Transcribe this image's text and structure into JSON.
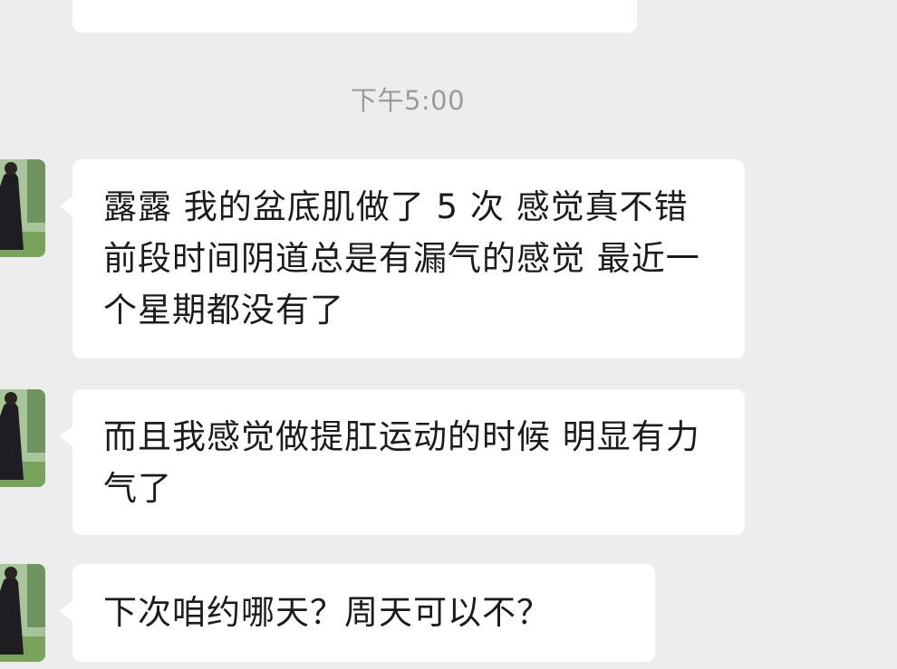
{
  "chat": {
    "timestamp": "下午5:00",
    "messages": [
      {
        "text": "露露  我的盆底肌做了 5 次  感觉真不错 前段时间阴道总是有漏气的感觉  最近一个星期都没有了"
      },
      {
        "text": "而且我感觉做提肛运动的时候  明显有力气了"
      },
      {
        "text": "下次咱约哪天？周天可以不？"
      }
    ]
  }
}
